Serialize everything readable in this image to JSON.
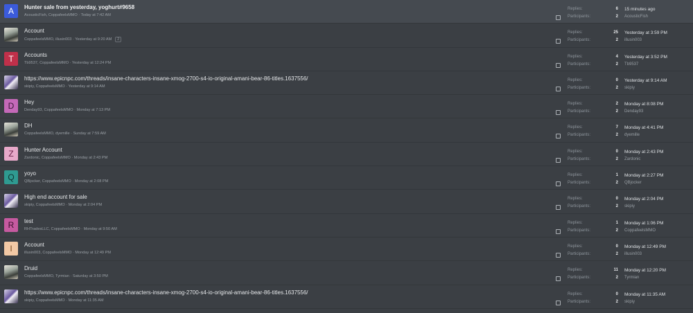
{
  "labels": {
    "replies": "Replies:",
    "participants": "Participants:"
  },
  "threads": [
    {
      "avatar_letter": "A",
      "avatar_color": "#3b5bdb",
      "avatar_type": "letter",
      "avatar_text_color": "#ffffff",
      "title": "Hunter sale from yesterday, yoghurt#9658",
      "meta": "AcousticFish, CoppafeelsMMO · Today at 7:42 AM",
      "pager": "",
      "replies": "6",
      "participants": "2",
      "last_time": "15 minutes ago",
      "last_user": "AcousticFish",
      "unread": true
    },
    {
      "avatar_letter": "",
      "avatar_color": "",
      "avatar_type": "image2",
      "avatar_text_color": "",
      "title": "Account",
      "meta": "CoppafeelsMMO, illusin003 · Yesterday at 9:20 AM",
      "pager": "2",
      "replies": "25",
      "participants": "2",
      "last_time": "Yesterday at 3:59 PM",
      "last_user": "illusin003",
      "unread": false
    },
    {
      "avatar_letter": "T",
      "avatar_color": "#c0304a",
      "avatar_type": "letter",
      "avatar_text_color": "#ffffff",
      "title": "Accounts",
      "meta": "Tb9537, CoppafeelsMMO · Yesterday at 12:24 PM",
      "pager": "",
      "replies": "4",
      "participants": "2",
      "last_time": "Yesterday at 3:52 PM",
      "last_user": "Tb9537",
      "unread": false
    },
    {
      "avatar_letter": "",
      "avatar_color": "",
      "avatar_type": "image",
      "avatar_text_color": "",
      "title": "https://www.epicnpc.com/threads/insane-characters-insane-xmog-2700-s4-io-original-amani-bear-86-titles.1637556/",
      "meta": "skipiy, CoppafeelsMMO · Yesterday at 9:14 AM",
      "pager": "",
      "replies": "0",
      "participants": "2",
      "last_time": "Yesterday at 9:14 AM",
      "last_user": "skipiy",
      "unread": false
    },
    {
      "avatar_letter": "D",
      "avatar_color": "#c469b8",
      "avatar_type": "letter",
      "avatar_text_color": "#3a1638",
      "title": "Hey",
      "meta": "Denday93, CoppafeelsMMO · Monday at 7:13 PM",
      "pager": "",
      "replies": "2",
      "participants": "2",
      "last_time": "Monday at 8:08 PM",
      "last_user": "Denday93",
      "unread": false
    },
    {
      "avatar_letter": "",
      "avatar_color": "",
      "avatar_type": "image2",
      "avatar_text_color": "",
      "title": "DH",
      "meta": "CoppafeelsMMO, dyemille · Sunday at 7:59 AM",
      "pager": "",
      "replies": "7",
      "participants": "2",
      "last_time": "Monday at 4:41 PM",
      "last_user": "dyemille",
      "unread": false
    },
    {
      "avatar_letter": "Z",
      "avatar_color": "#e7a8c9",
      "avatar_type": "letter",
      "avatar_text_color": "#6a2048",
      "title": "Hunter Account",
      "meta": "Zardonic, CoppafeelsMMO · Monday at 2:43 PM",
      "pager": "",
      "replies": "0",
      "participants": "2",
      "last_time": "Monday at 2:43 PM",
      "last_user": "Zardonic",
      "unread": false
    },
    {
      "avatar_letter": "Q",
      "avatar_color": "#2f9a91",
      "avatar_type": "letter",
      "avatar_text_color": "#0f3532",
      "title": "yoyo",
      "meta": "QBjocker, CoppafeelsMMO · Monday at 2:08 PM",
      "pager": "",
      "replies": "1",
      "participants": "2",
      "last_time": "Monday at 2:27 PM",
      "last_user": "QBjocker",
      "unread": false
    },
    {
      "avatar_letter": "",
      "avatar_color": "",
      "avatar_type": "image",
      "avatar_text_color": "",
      "title": "High end account for sale",
      "meta": "skipiy, CoppafeelsMMO · Monday at 2:04 PM",
      "pager": "",
      "replies": "0",
      "participants": "2",
      "last_time": "Monday at 2:04 PM",
      "last_user": "skipiy",
      "unread": false
    },
    {
      "avatar_letter": "R",
      "avatar_color": "#c65aa0",
      "avatar_type": "letter",
      "avatar_text_color": "#3a0f2d",
      "title": "test",
      "meta": "RHTradesLLC, CoppafeelsMMO · Monday at 9:50 AM",
      "pager": "",
      "replies": "1",
      "participants": "2",
      "last_time": "Monday at 1:06 PM",
      "last_user": "CoppafeelsMMO",
      "unread": false
    },
    {
      "avatar_letter": "I",
      "avatar_color": "#f3c9a5",
      "avatar_type": "letter",
      "avatar_text_color": "#7a4a22",
      "title": "Account",
      "meta": "illusin003, CoppafeelsMMO · Monday at 12:49 PM",
      "pager": "",
      "replies": "0",
      "participants": "2",
      "last_time": "Monday at 12:49 PM",
      "last_user": "illusin003",
      "unread": false
    },
    {
      "avatar_letter": "",
      "avatar_color": "",
      "avatar_type": "image2",
      "avatar_text_color": "",
      "title": "Druid",
      "meta": "CoppafeelsMMO, Tyrmian · Saturday at 3:50 PM",
      "pager": "",
      "replies": "11",
      "participants": "2",
      "last_time": "Monday at 12:20 PM",
      "last_user": "Tyrmian",
      "unread": false
    },
    {
      "avatar_letter": "",
      "avatar_color": "",
      "avatar_type": "image",
      "avatar_text_color": "",
      "title": "https://www.epicnpc.com/threads/insane-characters-insane-xmog-2700-s4-io-original-amani-bear-86-titles.1637556/",
      "meta": "skipiy, CoppafeelsMMO · Monday at 11:35 AM",
      "pager": "",
      "replies": "0",
      "participants": "2",
      "last_time": "Monday at 11:35 AM",
      "last_user": "skipiy",
      "unread": false
    }
  ]
}
